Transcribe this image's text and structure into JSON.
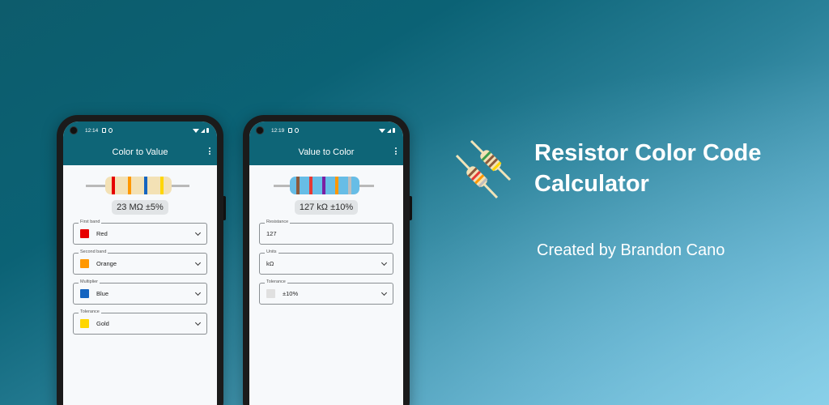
{
  "hero": {
    "title_line1": "Resistor Color Code",
    "title_line2": "Calculator",
    "subtitle": "Created by Brandon Cano",
    "logo_icon": "resistor-pair-icon"
  },
  "phones": [
    {
      "time": "12:14",
      "title": "Color to Value",
      "value": "23 MΩ ±5%",
      "body_color": "#f3e1b5",
      "bands": [
        "#e60000",
        "#ff9800",
        "#1565c0",
        "#ffd600"
      ],
      "fields": [
        {
          "label": "First band",
          "value": "Red",
          "swatch": "#e60000"
        },
        {
          "label": "Second band",
          "value": "Orange",
          "swatch": "#ff9800"
        },
        {
          "label": "Multiplier",
          "value": "Blue",
          "swatch": "#1565c0"
        },
        {
          "label": "Tolerance",
          "value": "Gold",
          "swatch": "#ffd600"
        }
      ]
    },
    {
      "time": "12:19",
      "title": "Value to Color",
      "value": "127 kΩ ±10%",
      "body_color": "#67bde6",
      "bands": [
        "#8d5a3c",
        "#e53935",
        "#7b1fa2",
        "#ff9800",
        "#bdbdbd"
      ],
      "fields": [
        {
          "label": "Resistance",
          "value": "127",
          "swatch": ""
        },
        {
          "label": "Units",
          "value": "kΩ",
          "swatch": ""
        },
        {
          "label": "Tolerance",
          "value": "±10%",
          "swatch": "#e0e0e0"
        }
      ]
    }
  ]
}
